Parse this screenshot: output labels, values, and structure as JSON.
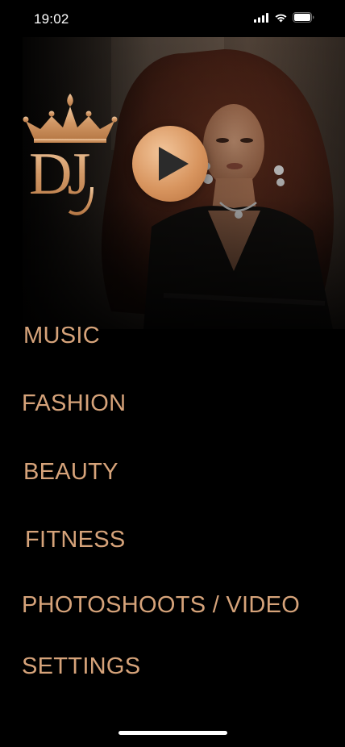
{
  "status_bar": {
    "time": "19:02",
    "icons": [
      "cellular-signal-icon",
      "wifi-icon",
      "battery-icon"
    ]
  },
  "hero": {
    "logo_text": "DJ",
    "play_icon": "play-icon",
    "accent_color": "#d6a37a"
  },
  "menu": {
    "items": [
      {
        "label": "MUSIC"
      },
      {
        "label": "FASHION"
      },
      {
        "label": "BEAUTY"
      },
      {
        "label": "FITNESS"
      },
      {
        "label": "PHOTOSHOOTS / VIDEO"
      },
      {
        "label": "SETTINGS"
      }
    ]
  }
}
